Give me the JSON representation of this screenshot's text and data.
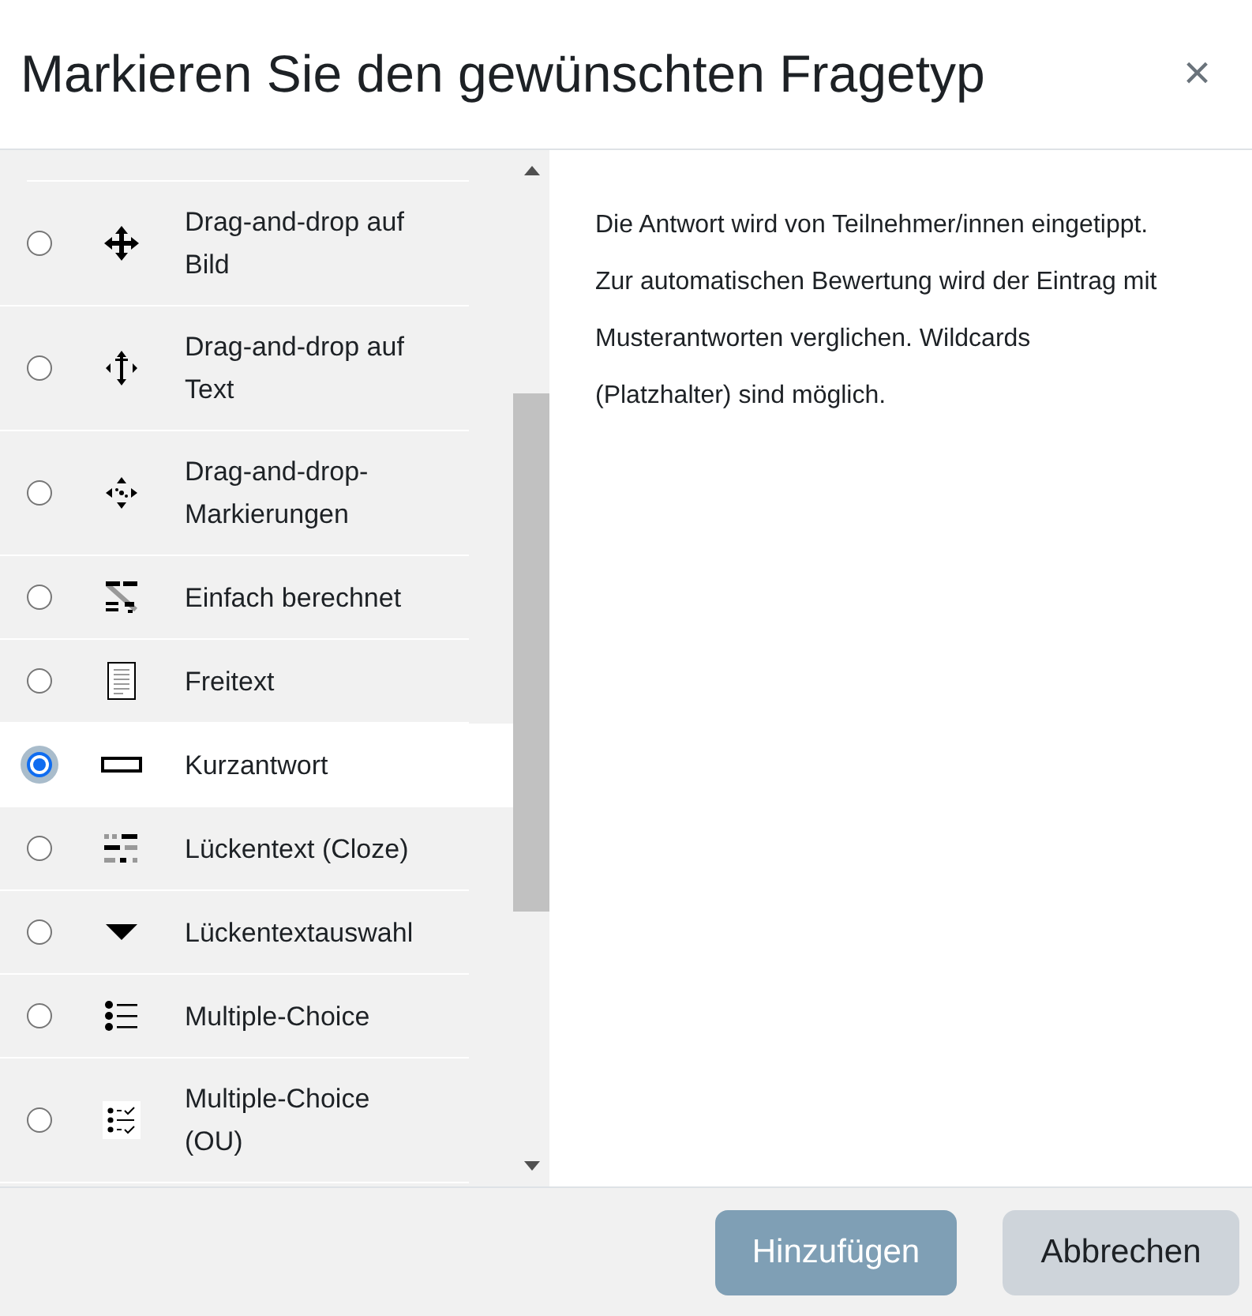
{
  "dialog": {
    "title": "Markieren Sie den gewünschten Fragetyp",
    "close": "×"
  },
  "types": [
    {
      "label": "Drag-and-drop auf Bild",
      "kind": "move",
      "selected": false
    },
    {
      "label": "Drag-and-drop auf Text",
      "kind": "move-text",
      "selected": false
    },
    {
      "label": "Drag-and-drop-Markierungen",
      "kind": "markers",
      "selected": false
    },
    {
      "label": "Einfach berechnet",
      "kind": "calc",
      "selected": false
    },
    {
      "label": "Freitext",
      "kind": "essay",
      "selected": false
    },
    {
      "label": "Kurzantwort",
      "kind": "short",
      "selected": true
    },
    {
      "label": "Lückentext (Cloze)",
      "kind": "cloze",
      "selected": false
    },
    {
      "label": "Lückentextauswahl",
      "kind": "select",
      "selected": false
    },
    {
      "label": "Multiple-Choice",
      "kind": "mc",
      "selected": false
    },
    {
      "label": "Multiple-Choice (OU)",
      "kind": "mc-check",
      "selected": false
    }
  ],
  "description": "Die Antwort wird von Teilnehmer/innen eingetippt. Zur automatischen Bewertung wird der Eintrag mit Musterantworten verglichen. Wildcards (Platzhalter) sind möglich.",
  "buttons": [
    {
      "label": "Hinzufügen",
      "kind": "primary"
    },
    {
      "label": "Abbrechen",
      "kind": "secondary"
    }
  ]
}
